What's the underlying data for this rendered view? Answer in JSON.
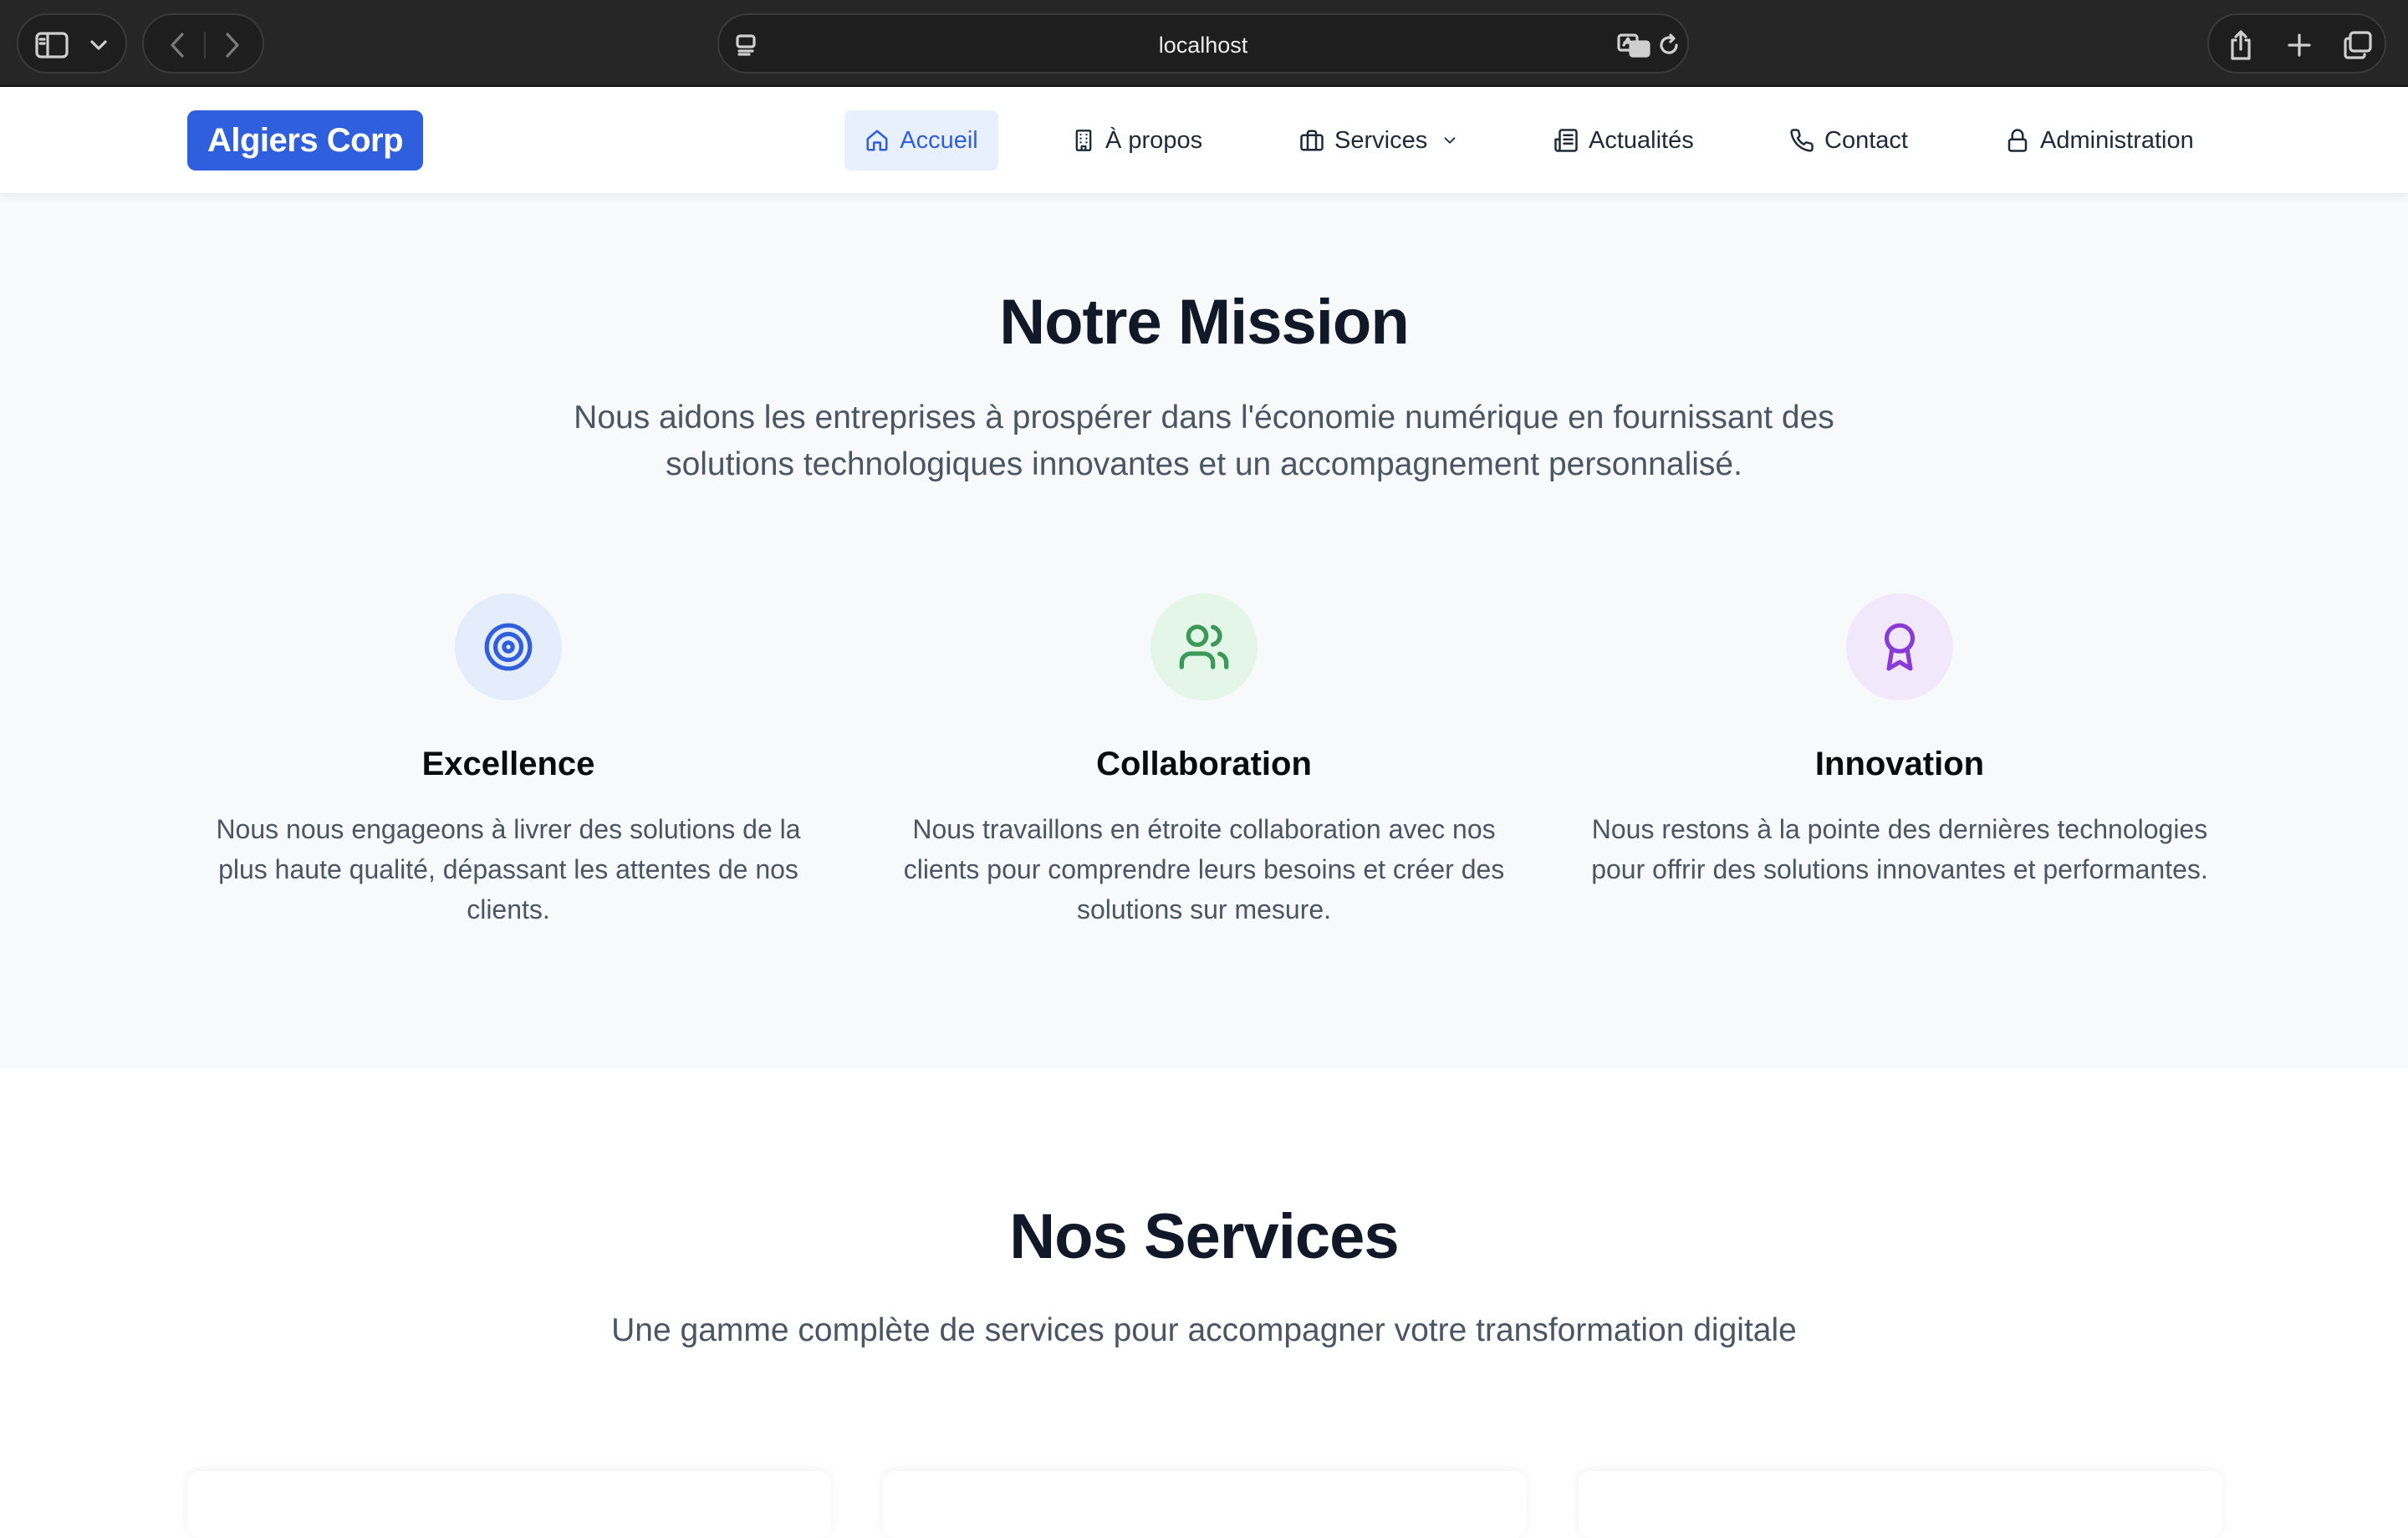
{
  "browser": {
    "url": "localhost",
    "icons": [
      "sidebar-icon",
      "chevron-down-icon",
      "back-icon",
      "forward-icon",
      "page-menu-icon",
      "translate-icon",
      "reload-icon",
      "share-icon",
      "new-tab-icon",
      "tabs-overview-icon"
    ]
  },
  "header": {
    "logo": "Algiers Corp",
    "nav": [
      {
        "label": "Accueil",
        "icon": "home-icon",
        "active": true
      },
      {
        "label": "À propos",
        "icon": "building-icon",
        "active": false
      },
      {
        "label": "Services",
        "icon": "briefcase-icon",
        "active": false,
        "dropdown": true
      },
      {
        "label": "Actualités",
        "icon": "newspaper-icon",
        "active": false
      },
      {
        "label": "Contact",
        "icon": "phone-icon",
        "active": false
      },
      {
        "label": "Administration",
        "icon": "lock-icon",
        "active": false
      }
    ]
  },
  "mission": {
    "title": "Notre Mission",
    "lead_line1": "Nous aidons les entreprises à prospérer dans l'économie numérique en fournissant des",
    "lead_line2": "solutions technologiques innovantes et un accompagnement personnalisé.",
    "values": [
      {
        "title": "Excellence",
        "icon": "target-icon",
        "color": "#2f5fdc",
        "bg": "#e5edfd",
        "text": "Nous nous engageons à livrer des solutions de la plus haute qualité, dépassant les attentes de nos clients."
      },
      {
        "title": "Collaboration",
        "icon": "users-icon",
        "color": "#3c9a58",
        "bg": "#e3f6e8",
        "text": "Nous travaillons en étroite collaboration avec nos clients pour comprendre leurs besoins et créer des solutions sur mesure."
      },
      {
        "title": "Innovation",
        "icon": "award-icon",
        "color": "#8a3ad6",
        "bg": "#f2e8fc",
        "text": "Nous restons à la pointe des dernières technologies pour offrir des solutions innovantes et performantes."
      }
    ]
  },
  "services": {
    "title": "Nos Services",
    "subtitle": "Une gamme complète de services pour accompagner votre transformation digitale"
  },
  "colors": {
    "brand": "#2f5fdc",
    "text_dark": "#111827",
    "text_muted": "#4b5563",
    "section_bg": "#f8f9fb"
  }
}
